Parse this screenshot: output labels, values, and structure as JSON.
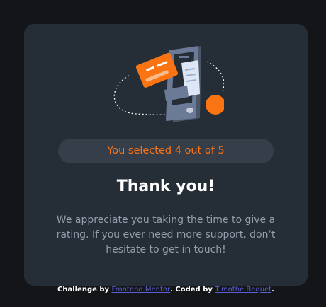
{
  "card": {
    "illustration_icon": "payment-receipt-illustration",
    "selection_text": "You selected 4 out of 5",
    "title": "Thank you!",
    "message": "We appreciate you taking the time to give a rating. If you ever need more support, don’t hesitate to get in touch!"
  },
  "footer": {
    "challenge_prefix": "Challenge by",
    "challenge_link": "Frontend Mentor",
    "coded_prefix": ". Coded by",
    "coder_link": "Timothé Bequet",
    "suffix": "."
  },
  "colors": {
    "page_bg": "#131518",
    "card_bg": "#252d37",
    "accent": "#fb7413",
    "pill_bg": "#363e4a",
    "muted_text": "#959eac",
    "link": "#5b5fd6"
  }
}
